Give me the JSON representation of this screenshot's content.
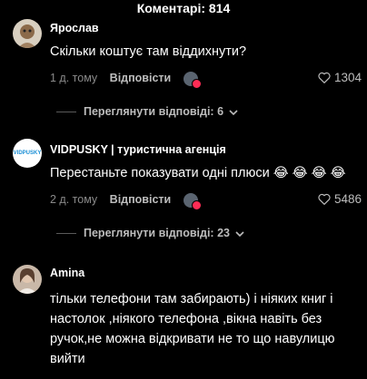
{
  "header": {
    "title": "Коментарі: 814"
  },
  "comments": [
    {
      "author": "Ярослав",
      "author_suffix": "",
      "text": "Скільки коштує там віддихнути?",
      "time": "1 д. тому",
      "reply_label": "Відповісти",
      "likes": "1304",
      "view_replies": "Переглянути відповіді: 6"
    },
    {
      "author": "VIDPUSKY",
      "author_suffix": " | туристична агенція",
      "avatar_text": "VIDPUSKY",
      "text": "Перестаньте показувати одні плюси 😂 😂 😂 😂",
      "time": "2 д. тому",
      "reply_label": "Відповісти",
      "likes": "5486",
      "view_replies": "Переглянути відповіді: 23"
    },
    {
      "author": "Amina",
      "author_suffix": "",
      "text": "тільки телефони там забирають) і ніяких книг і настолок ,ніякого телефона ,вікна навіть без ручок,не можна відкривати не то що навулицю вийти"
    }
  ],
  "colors": {
    "background": "#000000",
    "muted": "#8a8a8a",
    "badge": "#fe2c55"
  }
}
